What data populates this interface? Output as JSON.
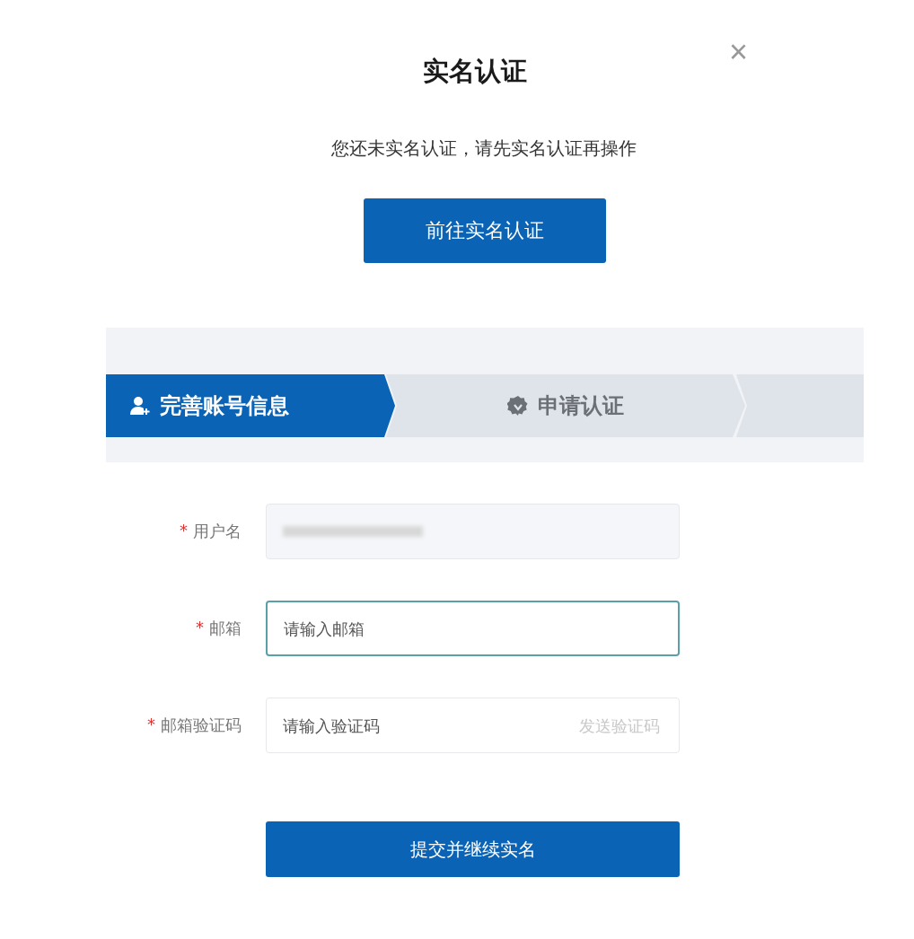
{
  "dialog": {
    "title": "实名认证",
    "close": "×"
  },
  "notice": {
    "message": "您还未实名认证，请先实名认证再操作",
    "button": "前往实名认证"
  },
  "steps": [
    {
      "label": "完善账号信息",
      "selected": true
    },
    {
      "label": "申请认证",
      "selected": false
    }
  ],
  "form": {
    "fields": [
      {
        "kind": "readonly",
        "marker": "*",
        "label": "用户名",
        "focused": false
      },
      {
        "kind": "input",
        "marker": "*",
        "label": "邮箱",
        "placeholder": "请输入邮箱",
        "focused": true
      },
      {
        "kind": "code",
        "marker": "*",
        "label": "邮箱验证码",
        "placeholder": "请输入验证码",
        "action": "发送验证码",
        "focused": false
      }
    ],
    "submit": "提交并继续实名"
  }
}
